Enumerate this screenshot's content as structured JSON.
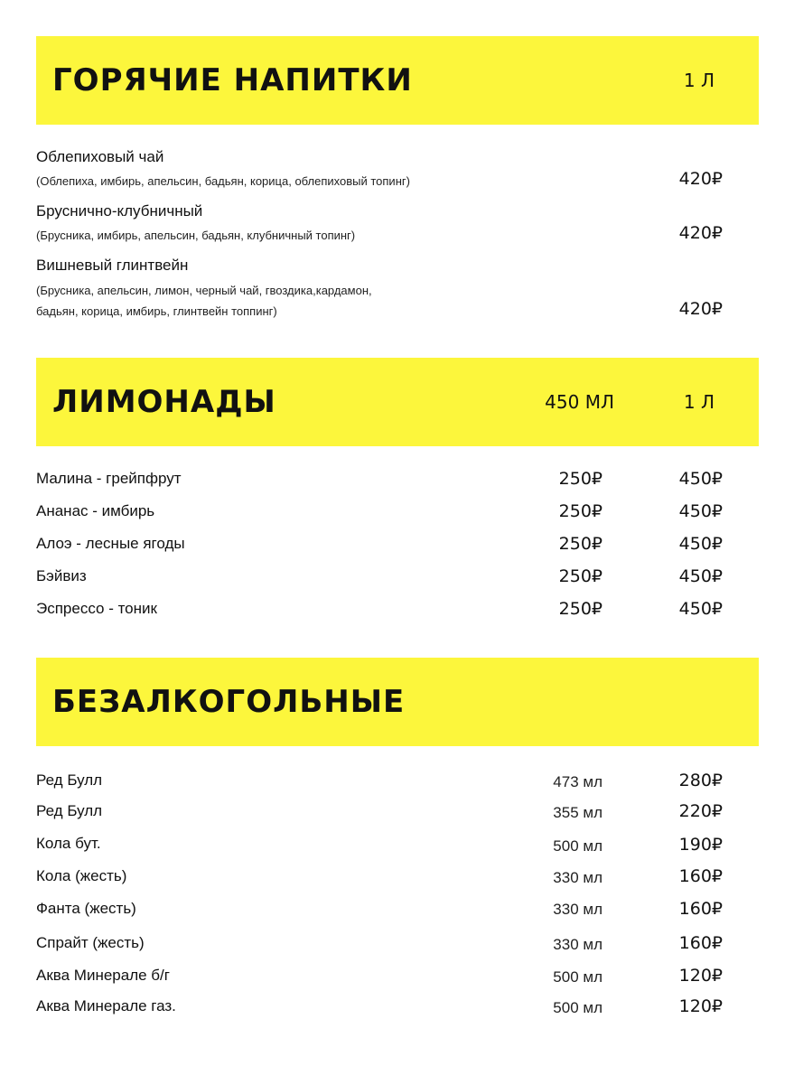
{
  "hot": {
    "title": "Горячие напитки",
    "col": "1 л",
    "items": [
      {
        "name": "Облепиховый чай",
        "desc": [
          "(Облепиха, имбирь, апельсин, бадьян, корица, облепиховый топинг)"
        ],
        "price": "420₽"
      },
      {
        "name": "Бруснично-клубничный",
        "desc": [
          "(Брусника, имбирь, апельсин, бадьян, клубничный топинг)"
        ],
        "price": "420₽"
      },
      {
        "name": "Вишневый глинтвейн",
        "desc": [
          "(Брусника, апельсин, лимон, черный чай, гвоздика,кардамон,",
          "бадьян, корица, имбирь, глинтвейн топпинг)"
        ],
        "price": "420₽"
      }
    ]
  },
  "lemonades": {
    "title": "Лимонады",
    "col1": "450 мл",
    "col2": "1 л",
    "items": [
      {
        "name": "Малина - грейпфрут",
        "p1": "250₽",
        "p2": "450₽"
      },
      {
        "name": "Ананас - имбирь",
        "p1": "250₽",
        "p2": "450₽"
      },
      {
        "name": "Алоэ - лесные ягоды",
        "p1": "250₽",
        "p2": "450₽"
      },
      {
        "name": "Бэйвиз",
        "p1": "250₽",
        "p2": "450₽"
      },
      {
        "name": "Эспрессо - тоник",
        "p1": "250₽",
        "p2": "450₽"
      }
    ]
  },
  "soft": {
    "title": "Безалкогольные",
    "items": [
      {
        "name": "Ред Булл",
        "volume": "473 мл",
        "price": "280₽"
      },
      {
        "name": "Ред Булл",
        "volume": "355 мл",
        "price": "220₽"
      },
      {
        "name": "Кола бут.",
        "volume": "500 мл",
        "price": "190₽"
      },
      {
        "name": "Кола (жесть)",
        "volume": "330 мл",
        "price": "160₽"
      },
      {
        "name": "Фанта (жесть)",
        "volume": "330 мл",
        "price": "160₽"
      },
      {
        "name": "Спрайт (жесть)",
        "volume": "330 мл",
        "price": "160₽"
      },
      {
        "name": "Аква Минерале б/г",
        "volume": "500 мл",
        "price": "120₽"
      },
      {
        "name": "Аква Минерале газ.",
        "volume": "500 мл",
        "price": "120₽"
      }
    ]
  }
}
